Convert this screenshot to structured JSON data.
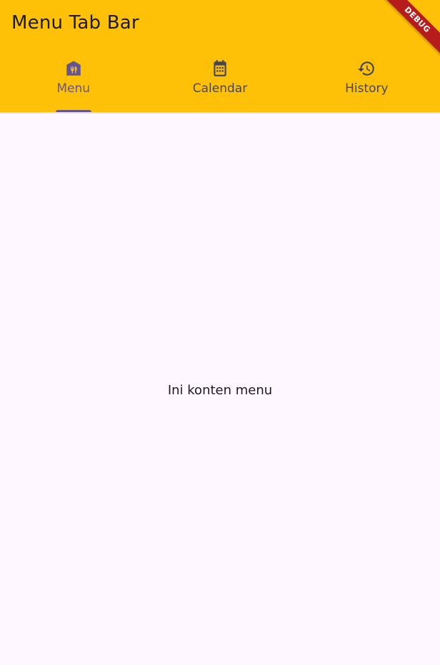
{
  "appbar": {
    "title": "Menu Tab Bar",
    "background": "#ffc107"
  },
  "tabs": [
    {
      "label": "Menu",
      "icon": "restaurant-icon",
      "active": true
    },
    {
      "label": "Calendar",
      "icon": "calendar-icon",
      "active": false
    },
    {
      "label": "History",
      "icon": "history-icon",
      "active": false
    }
  ],
  "content": {
    "text": "Ini konten menu"
  },
  "debug_banner": {
    "label": "DEBUG"
  },
  "colors": {
    "accent": "#65558f",
    "tab_label_inactive": "#49454f",
    "background": "#fef7ff"
  }
}
